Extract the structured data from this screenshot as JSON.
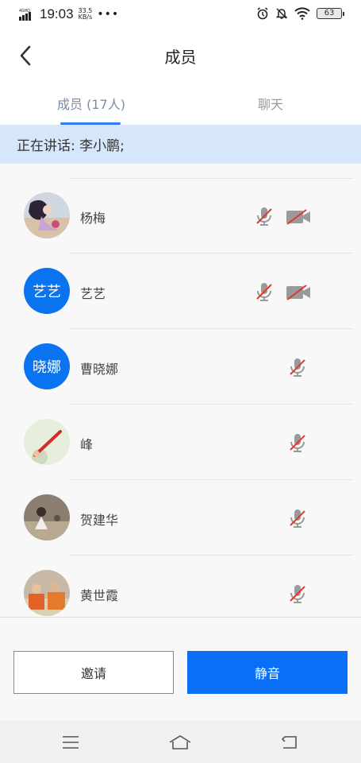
{
  "status_bar": {
    "network": "4GHD",
    "time": "19:03",
    "speed_value": "33.5",
    "speed_unit": "KB/s",
    "more": "•••",
    "battery": "63",
    "icons": [
      "alarm-icon",
      "bell-off-icon",
      "wifi-icon",
      "battery-icon"
    ]
  },
  "header": {
    "title": "成员"
  },
  "tabs": [
    {
      "label": "成员 (17人)",
      "active": true
    },
    {
      "label": "聊天",
      "active": false
    }
  ],
  "speaking": {
    "text": "正在讲话: 李小鹏;"
  },
  "members": [
    {
      "name": "杨梅",
      "avatar_type": "photo",
      "avatar_text": "",
      "mic": "muted",
      "camera": "off"
    },
    {
      "name": "艺艺",
      "avatar_type": "text",
      "avatar_text": "艺艺",
      "mic": "muted",
      "camera": "off"
    },
    {
      "name": "曹晓娜",
      "avatar_type": "text",
      "avatar_text": "晓娜",
      "mic": "muted",
      "camera": "none"
    },
    {
      "name": "峰",
      "avatar_type": "photo",
      "avatar_text": "",
      "mic": "muted",
      "camera": "none"
    },
    {
      "name": "贺建华",
      "avatar_type": "photo",
      "avatar_text": "",
      "mic": "muted",
      "camera": "none"
    },
    {
      "name": "黄世霞",
      "avatar_type": "photo",
      "avatar_text": "",
      "mic": "muted",
      "camera": "none"
    }
  ],
  "actions": {
    "invite_label": "邀请",
    "mute_label": "静音"
  },
  "colors": {
    "accent": "#0a6ef6",
    "banner": "#d6e6fb",
    "muted_red": "#e0392b"
  },
  "system_nav": {
    "icons": [
      "menu-icon",
      "home-icon",
      "back-icon"
    ]
  }
}
